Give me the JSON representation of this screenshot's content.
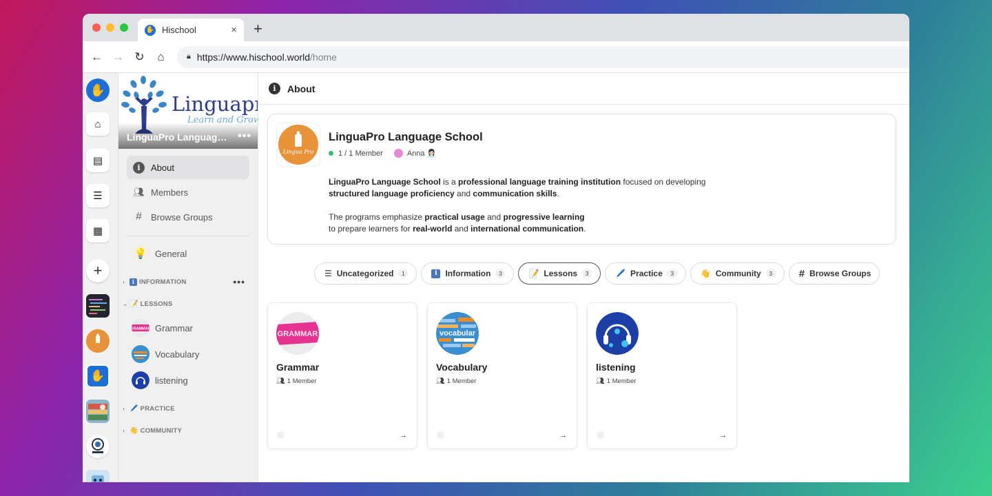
{
  "browser": {
    "tab_title": "Hischool",
    "new_tab_label": "+",
    "tab_close_label": "×",
    "url_host": "https://www.hischool.world",
    "url_path": "/home"
  },
  "org": {
    "banner_logo_text": "Linguapro",
    "banner_tagline": "Learn and Grow",
    "banner_name": "LinguaPro Language School",
    "name": "LinguaPro Language School",
    "member_count": "1 / 1 Member",
    "member_name": "Anna 👩🏻‍💼",
    "logo_text": "Lingua Pro"
  },
  "sidebar": {
    "nav": [
      {
        "label": "About"
      },
      {
        "label": "Members"
      },
      {
        "label": "Browse Groups"
      }
    ],
    "general_label": "General",
    "categories": {
      "information": "INFORMATION",
      "lessons": "LESSONS",
      "practice": "PRACTICE",
      "community": "COMMUNITY"
    },
    "lesson_channels": [
      {
        "label": "Grammar"
      },
      {
        "label": "Vocabulary"
      },
      {
        "label": "listening"
      }
    ]
  },
  "main": {
    "header_title": "About",
    "description": {
      "p1_a": "LinguaPro Language School",
      "p1_b": " is a ",
      "p1_c": "professional language training institution",
      "p1_d": " focused on developing",
      "p1_e": "structured language proficiency",
      "p1_f": " and ",
      "p1_g": "communication skills",
      "p1_h": ".",
      "p2_a": "The programs emphasize ",
      "p2_b": "practical usage",
      "p2_c": " and ",
      "p2_d": "progressive learning",
      "p2_e": "to prepare learners for ",
      "p2_f": "real-world",
      "p2_g": " and ",
      "p2_h": "international communication",
      "p2_i": "."
    },
    "tabs": [
      {
        "label": "Uncategorized",
        "count": "1"
      },
      {
        "label": "Information",
        "count": "3"
      },
      {
        "label": "Lessons",
        "count": "3"
      },
      {
        "label": "Practice",
        "count": "3"
      },
      {
        "label": "Community",
        "count": "3"
      },
      {
        "label": "Browse Groups"
      }
    ],
    "groups": [
      {
        "title": "Grammar",
        "members": "1 Member",
        "thumb_text": "GRAMMAR"
      },
      {
        "title": "Vocabulary",
        "members": "1 Member",
        "thumb_text": "vocabular"
      },
      {
        "title": "listening",
        "members": "1 Member"
      }
    ]
  },
  "colors": {
    "accent_blue": "#1d6fd8",
    "online_green": "#3cb878",
    "logo_orange": "#e8923a"
  }
}
